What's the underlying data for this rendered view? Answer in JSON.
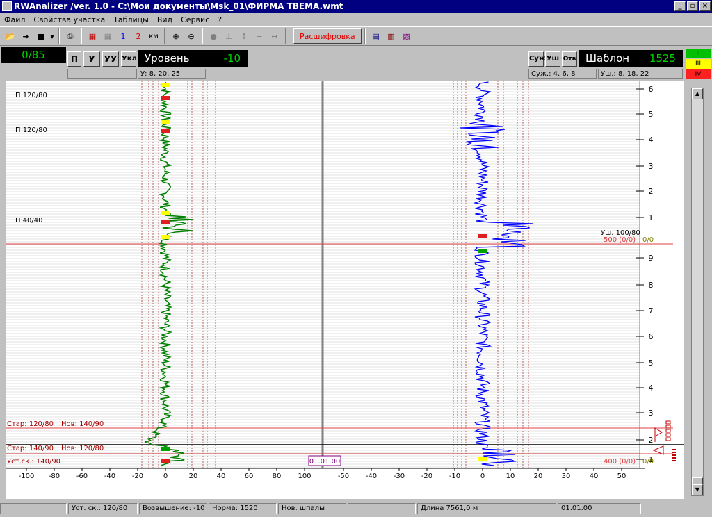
{
  "window": {
    "title": "RWAnalizer /ver. 1.0 - C:\\Мои документы\\Msk_01\\ФИРМА    TBEMA.wmt",
    "minimize": "_",
    "maximize": "▫",
    "close": "×"
  },
  "menu": [
    "Файл",
    "Свойства участка",
    "Таблицы",
    "Вид",
    "Сервис",
    "?"
  ],
  "toolbar": {
    "decode_label": "Расшифровка",
    "channel1": "1",
    "channel2": "2",
    "km_label": "км"
  },
  "counter": "0/85",
  "level_panel": {
    "buttons": [
      "П",
      "У",
      "УУ",
      "Укл"
    ],
    "label": "Уровень",
    "value": "-10",
    "sub": "У: 8, 20, 25"
  },
  "gauge_panel": {
    "buttons": [
      "Суж",
      "Уш",
      "Отв"
    ],
    "label": "Шаблон",
    "value": "1525",
    "sub_narrow": "Суж.: 4, 6, 8",
    "sub_wide": "Уш.: 8, 18, 22"
  },
  "classes": [
    {
      "label": "II",
      "color": "#00c000"
    },
    {
      "label": "III",
      "color": "#ffff00"
    },
    {
      "label": "IV",
      "color": "#ff2020"
    }
  ],
  "chart_data": {
    "type": "line",
    "left_axis_ticks": [
      "-100",
      "-80",
      "-60",
      "-40",
      "-20",
      "0",
      "20",
      "40",
      "60",
      "80",
      "100"
    ],
    "right_axis_ticks": [
      "-50",
      "-40",
      "-30",
      "-20",
      "-10",
      "0",
      "10",
      "20",
      "30",
      "40",
      "50"
    ],
    "pickets": [
      "6",
      "5",
      "4",
      "3",
      "2",
      "1",
      "9",
      "8",
      "7",
      "6",
      "5",
      "4",
      "3",
      "2",
      "1"
    ],
    "curve_labels": [
      "П 120/80",
      "П 120/80",
      "П 40/40"
    ],
    "speed_labels": [
      "Стар: 120/80",
      "Нов: 140/90",
      "Стар: 140/90",
      "Нов: 120/80",
      "Уст.ск.: 140/90"
    ],
    "date_marker": "01.01.00",
    "km_marks": [
      "500 (0/0)",
      "400 (0/0)"
    ],
    "km_suffix": "0/0",
    "wide_note": "Уш. 100/80",
    "series": [
      {
        "name": "Уровень",
        "color": "#008000"
      },
      {
        "name": "Шаблон",
        "color": "#0000ff"
      }
    ]
  },
  "status": {
    "speed": "Уст. ск.: 120/80",
    "elevation": "Возвышение: -10",
    "norm": "Норма: 1520",
    "sleepers": "Нов. шпалы",
    "length": "Длина 7561,0 м",
    "date": "01.01.00"
  }
}
